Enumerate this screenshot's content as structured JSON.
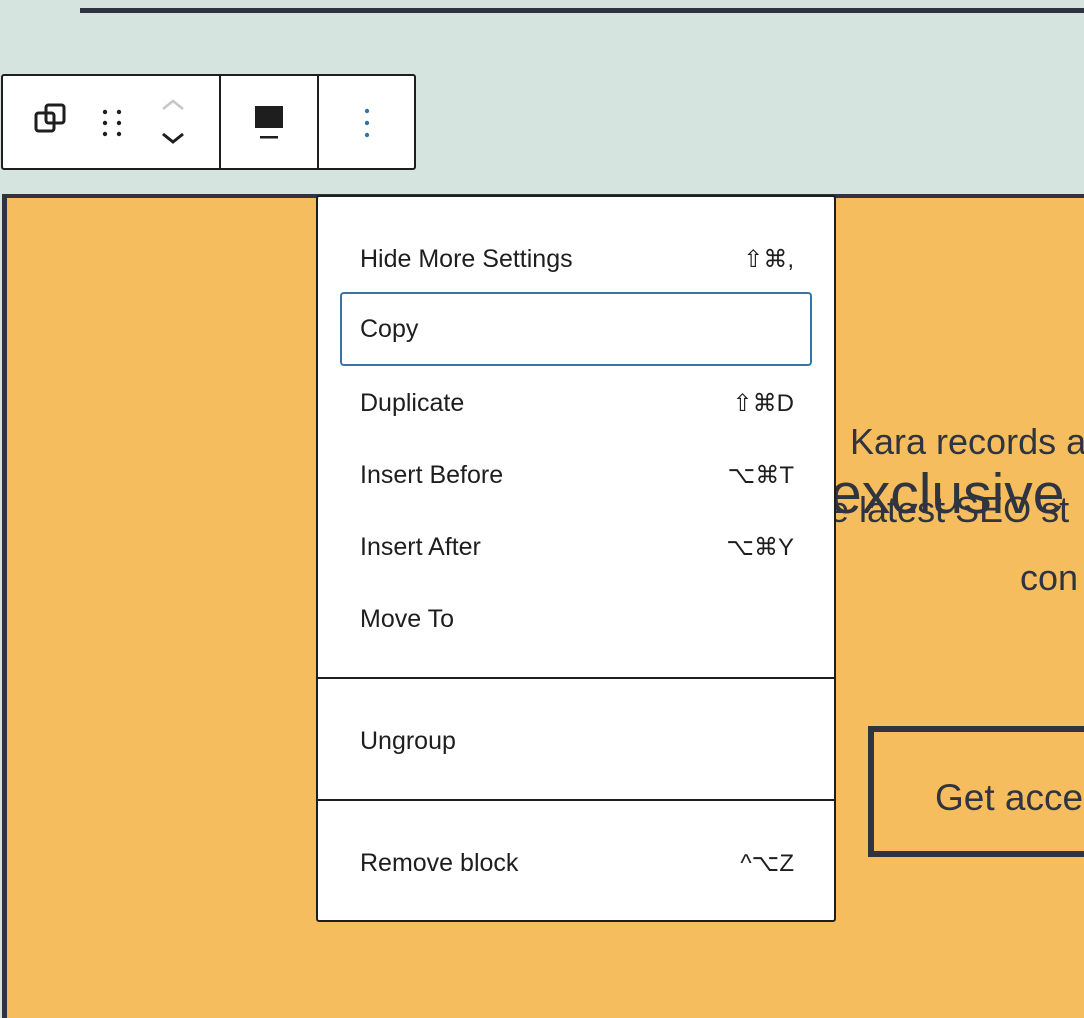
{
  "canvas": {
    "heading": "exclusive",
    "body_lines": [
      "Kara records a",
      "e latest SEO st",
      "con"
    ],
    "cta_label": "Get acce"
  },
  "toolbar": {
    "buttons": [
      {
        "name": "transform-block",
        "icon": "duplicate-squares-icon"
      },
      {
        "name": "drag-handle",
        "icon": "drag-dots-icon"
      },
      {
        "name": "move-up",
        "icon": "chevron-up-icon"
      },
      {
        "name": "move-down",
        "icon": "chevron-down-icon"
      },
      {
        "name": "change-alignment",
        "icon": "align-block-icon"
      },
      {
        "name": "options",
        "icon": "more-vertical-icon"
      }
    ],
    "accent_color": "#3574a8"
  },
  "menu": {
    "sections": [
      {
        "items": [
          {
            "label": "Hide More Settings",
            "shortcut": "⇧⌘,"
          },
          {
            "label": "Copy",
            "shortcut": ""
          },
          {
            "label": "Duplicate",
            "shortcut": "⇧⌘D"
          },
          {
            "label": "Insert Before",
            "shortcut": "⌥⌘T"
          },
          {
            "label": "Insert After",
            "shortcut": "⌥⌘Y"
          },
          {
            "label": "Move To",
            "shortcut": ""
          }
        ]
      },
      {
        "items": [
          {
            "label": "Ungroup",
            "shortcut": ""
          }
        ]
      },
      {
        "items": [
          {
            "label": "Remove block",
            "shortcut": "^⌥Z"
          }
        ]
      }
    ],
    "focused_item": "Copy"
  },
  "colors": {
    "editor_bg": "#d5e4de",
    "block_bg": "#f6bd5e",
    "block_text": "#2f3440",
    "focus_ring": "#3574a8"
  }
}
